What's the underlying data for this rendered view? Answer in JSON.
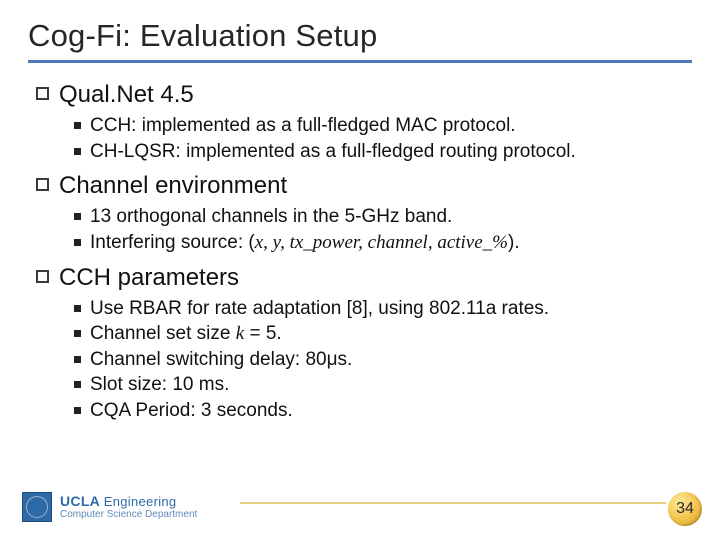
{
  "title": "Cog-Fi: Evaluation Setup",
  "sections": [
    {
      "heading": "Qual.Net 4.5",
      "items": [
        {
          "text": "CCH: implemented as a full-fledged MAC protocol."
        },
        {
          "text": "CH-LQSR: implemented as a full-fledged routing protocol."
        }
      ]
    },
    {
      "heading": "Channel environment",
      "items": [
        {
          "text": "13 orthogonal channels in the 5-GHz band."
        },
        {
          "prefix": "Interfering source: (",
          "italic": "x, y, tx_power, channel, active_%",
          "suffix": ")."
        }
      ]
    },
    {
      "heading": "CCH parameters",
      "items": [
        {
          "text": "Use RBAR for rate adaptation [8], using 802.11a rates."
        },
        {
          "prefix": "Channel set size ",
          "italic": "k",
          "suffix": " = 5."
        },
        {
          "prefix": "Channel switching delay: 80",
          "suffix": "μs."
        },
        {
          "text": "Slot size: 10 ms."
        },
        {
          "text": "CQA Period: 3 seconds."
        }
      ]
    }
  ],
  "footer": {
    "org_top": "UCLA",
    "org_suffix": "Engineering",
    "org_bottom": "Computer Science Department"
  },
  "page_number": "34"
}
